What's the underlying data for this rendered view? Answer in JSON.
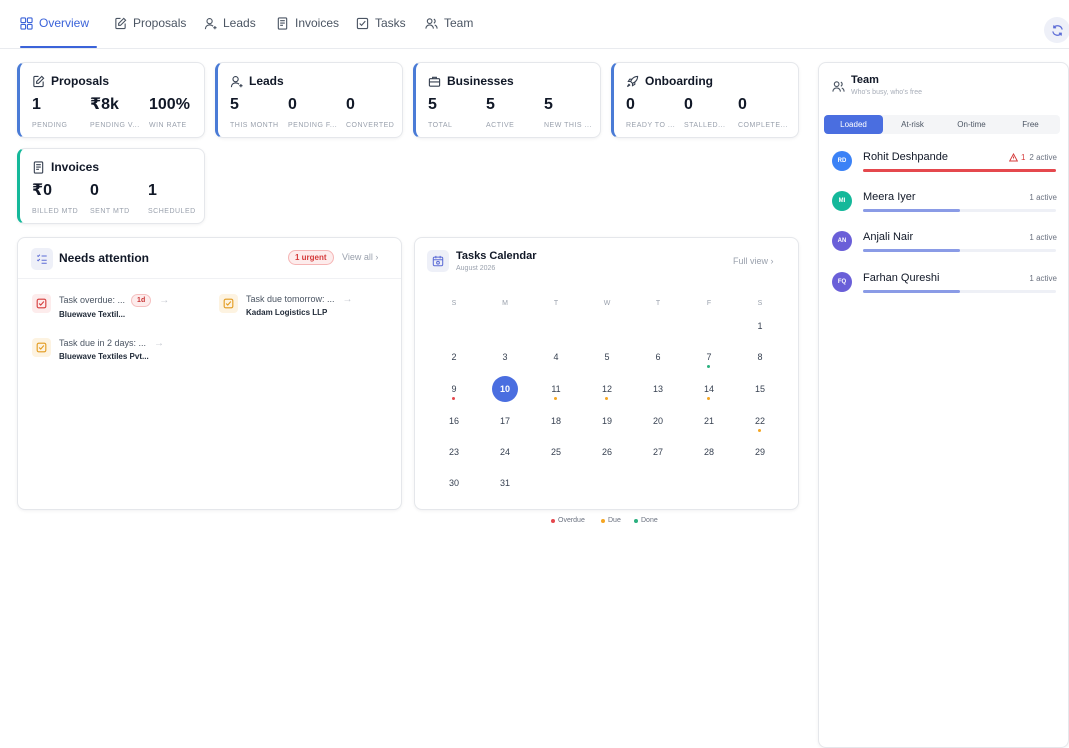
{
  "nav": {
    "tabs": [
      {
        "label": "Overview",
        "icon": "grid-icon"
      },
      {
        "label": "Proposals",
        "icon": "edit-icon"
      },
      {
        "label": "Leads",
        "icon": "user-icon"
      },
      {
        "label": "Invoices",
        "icon": "file-icon"
      },
      {
        "label": "Tasks",
        "icon": "checkbox-icon"
      },
      {
        "label": "Team",
        "icon": "users-icon"
      }
    ],
    "active": "Overview"
  },
  "stats": {
    "proposals": {
      "title": "Proposals",
      "items": [
        {
          "value": "1",
          "label": "PENDING"
        },
        {
          "value": "₹8k",
          "label": "PENDING V..."
        },
        {
          "value": "100%",
          "label": "WIN RATE"
        }
      ]
    },
    "leads": {
      "title": "Leads",
      "items": [
        {
          "value": "5",
          "label": "THIS MONTH"
        },
        {
          "value": "0",
          "label": "PENDING F..."
        },
        {
          "value": "0",
          "label": "CONVERTED"
        }
      ]
    },
    "businesses": {
      "title": "Businesses",
      "items": [
        {
          "value": "5",
          "label": "TOTAL"
        },
        {
          "value": "5",
          "label": "ACTIVE"
        },
        {
          "value": "5",
          "label": "NEW THIS ..."
        }
      ]
    },
    "onboarding": {
      "title": "Onboarding",
      "items": [
        {
          "value": "0",
          "label": "READY TO ..."
        },
        {
          "value": "0",
          "label": "STALLED..."
        },
        {
          "value": "0",
          "label": "COMPLETE..."
        }
      ]
    },
    "invoices": {
      "title": "Invoices",
      "items": [
        {
          "value": "₹0",
          "label": "BILLED MTD"
        },
        {
          "value": "0",
          "label": "SENT MTD"
        },
        {
          "value": "1",
          "label": "SCHEDULED"
        }
      ]
    }
  },
  "attention": {
    "title": "Needs attention",
    "badge": "1 urgent",
    "view_all": "View all",
    "items": [
      {
        "text": "Task overdue: ...",
        "sub": "Bluewave Textil...",
        "age": "1d"
      },
      {
        "text": "Task due tomorrow: ...",
        "sub": "Kadam Logistics LLP"
      },
      {
        "text": "Task due in 2 days: ...",
        "sub": "Bluewave Textiles Pvt..."
      }
    ]
  },
  "calendar": {
    "title": "Tasks Calendar",
    "subtitle": "August 2026",
    "full_view": "Full view",
    "weekdays": [
      "S",
      "M",
      "T",
      "W",
      "T",
      "F",
      "S"
    ],
    "today": 10,
    "first_weekday": 6,
    "days_in_month": 31,
    "markers": {
      "7": "done",
      "9": "overdue",
      "11": "due",
      "12": "due",
      "14": "due",
      "22": "due"
    },
    "legend": [
      {
        "label": "Overdue",
        "color": "#e5484d"
      },
      {
        "label": "Due",
        "color": "#f5a623"
      },
      {
        "label": "Done",
        "color": "#2bb07f"
      }
    ]
  },
  "team": {
    "title": "Team",
    "subtitle": "Who's busy, who's free",
    "filters": [
      "Loaded",
      "At-risk",
      "On-time",
      "Free"
    ],
    "active_filter": "Loaded",
    "members": [
      {
        "initials": "RD",
        "name": "Rohit Deshpande",
        "warn": "1",
        "active": "2 active",
        "load": 1.0,
        "avatar_color": "#3b82f6",
        "bar_color": "#e5484d"
      },
      {
        "initials": "MI",
        "name": "Meera Iyer",
        "active": "1 active",
        "load": 0.5,
        "avatar_color": "#14b89a",
        "bar_color": "#8a9be6"
      },
      {
        "initials": "AN",
        "name": "Anjali Nair",
        "active": "1 active",
        "load": 0.5,
        "avatar_color": "#6a5fd8",
        "bar_color": "#8a9be6"
      },
      {
        "initials": "FQ",
        "name": "Farhan Qureshi",
        "active": "1 active",
        "load": 0.5,
        "avatar_color": "#6a5fd8",
        "bar_color": "#8a9be6"
      }
    ]
  }
}
